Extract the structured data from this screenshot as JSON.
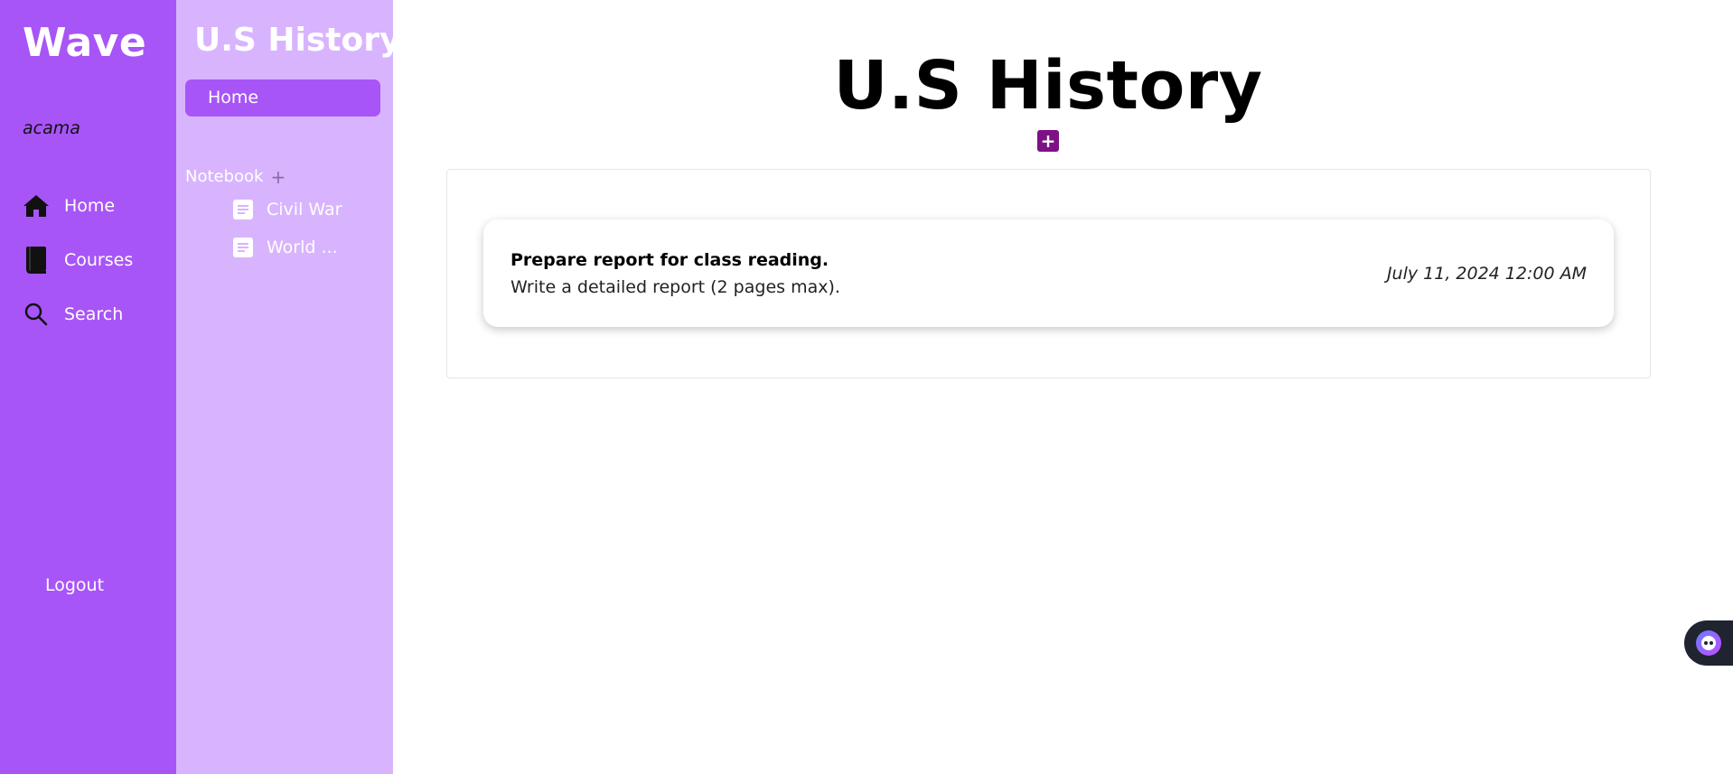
{
  "app": {
    "brand": "Wave",
    "username": "acama"
  },
  "nav": {
    "items": [
      {
        "label": "Home",
        "icon": "home-icon"
      },
      {
        "label": "Courses",
        "icon": "book-icon"
      },
      {
        "label": "Search",
        "icon": "search-icon"
      }
    ],
    "logout_label": "Logout"
  },
  "course_sidebar": {
    "title": "U.S History",
    "home_label": "Home",
    "notebook_label": "Notebook",
    "notebook_add": "+",
    "notes": [
      {
        "label": "Civil War",
        "icon": "document-icon"
      },
      {
        "label": "World ...",
        "icon": "document-icon"
      }
    ]
  },
  "main": {
    "title": "U.S History",
    "add_button": "+",
    "tasks": [
      {
        "title": "Prepare report for class reading.",
        "description": "Write a detailed report (2 pages max).",
        "due": "July 11, 2024 12:00 AM"
      }
    ]
  },
  "colors": {
    "primary_purple": "#a855f7",
    "light_purple": "#d8b4fe",
    "add_button": "#7e1185",
    "widget_bg": "#1f2430"
  },
  "widget": {
    "icon": "assistant-face-icon"
  }
}
